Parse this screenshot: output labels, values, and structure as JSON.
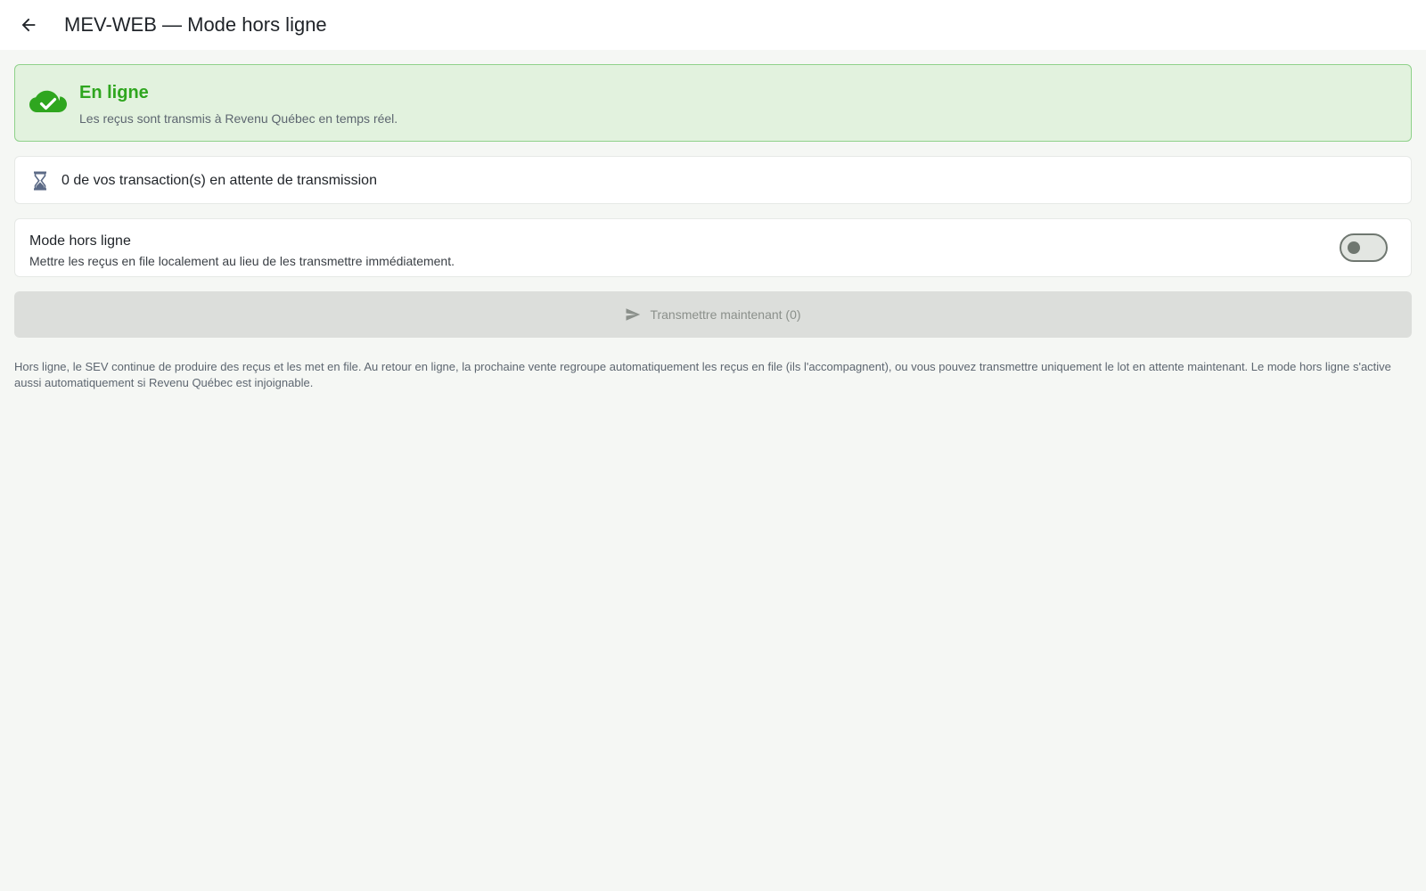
{
  "appbar": {
    "back_icon": "arrow-left-icon",
    "title": "MEV-WEB — Mode hors ligne"
  },
  "status": {
    "icon": "cloud-check-icon",
    "title": "En ligne",
    "subtitle": "Les reçus sont transmis à Revenu Québec en temps réel.",
    "color": "#2fa61f",
    "background": "#e2f2de",
    "border": "#8fd18a"
  },
  "pending": {
    "icon": "hourglass-icon",
    "text": "0 de vos transaction(s) en attente de transmission"
  },
  "offline_mode": {
    "title": "Mode hors ligne",
    "description": "Mettre les reçus en file localement au lieu de les transmettre immédiatement.",
    "enabled": false
  },
  "transmit": {
    "icon": "send-icon",
    "label": "Transmettre maintenant (0)",
    "disabled": true
  },
  "help": {
    "text": "Hors ligne, le SEV continue de produire des reçus et les met en file. Au retour en ligne, la prochaine vente regroupe automatiquement les reçus en file (ils l'accompagnent), ou vous pouvez transmettre uniquement le lot en attente maintenant. Le mode hors ligne s'active aussi automatiquement si Revenu Québec est injoignable."
  }
}
